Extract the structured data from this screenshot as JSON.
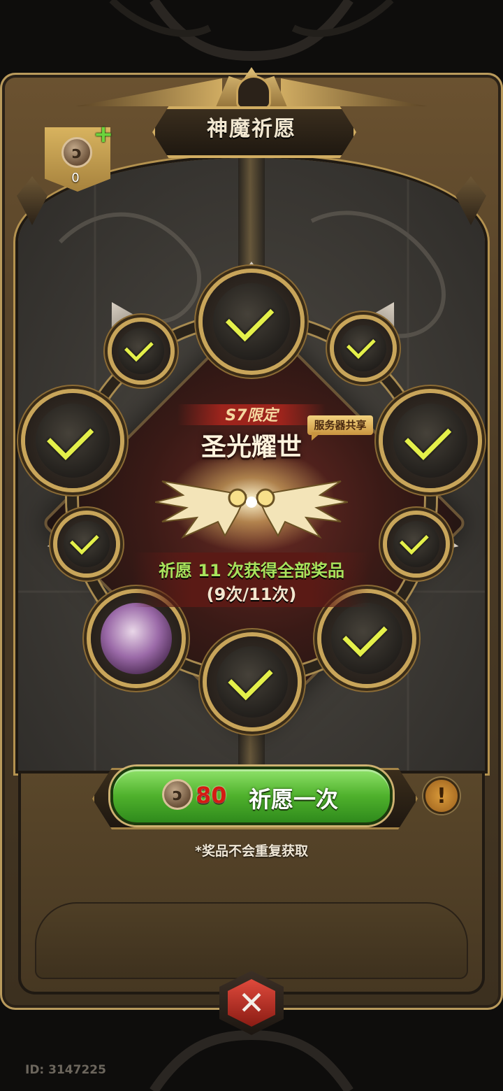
{
  "title": "神魔祈愿",
  "currency": {
    "icon": "pray-coin-icon",
    "count": "0"
  },
  "event": {
    "season_label": "S7限定",
    "name": "圣光耀世",
    "server_tag": "服务器共享",
    "progress_title": "祈愿 11 次获得全部奖品",
    "progress_count": "(9次/11次)",
    "progress": {
      "done": 9,
      "total": 11
    }
  },
  "rewards": [
    {
      "slot": "top",
      "claimed": true
    },
    {
      "slot": "upper-right-small",
      "claimed": true
    },
    {
      "slot": "right",
      "claimed": true
    },
    {
      "slot": "lower-right-small",
      "claimed": false
    },
    {
      "slot": "bottom-right",
      "claimed": true
    },
    {
      "slot": "bottom",
      "claimed": true
    },
    {
      "slot": "bottom-left",
      "claimed": false
    },
    {
      "slot": "lower-left-small",
      "claimed": true
    },
    {
      "slot": "left",
      "claimed": true
    },
    {
      "slot": "upper-left-small",
      "claimed": true
    }
  ],
  "pray_button": {
    "cost": "80",
    "label": "祈愿一次"
  },
  "note": "*奖品不会重复获取",
  "user_id": "ID: 3147225",
  "colors": {
    "accent_gold": "#c8a55a",
    "check_yellow": "#e4f04a",
    "button_green": "#4fb12c",
    "cost_red": "#d41b12",
    "progress_green": "#a8e25c"
  }
}
